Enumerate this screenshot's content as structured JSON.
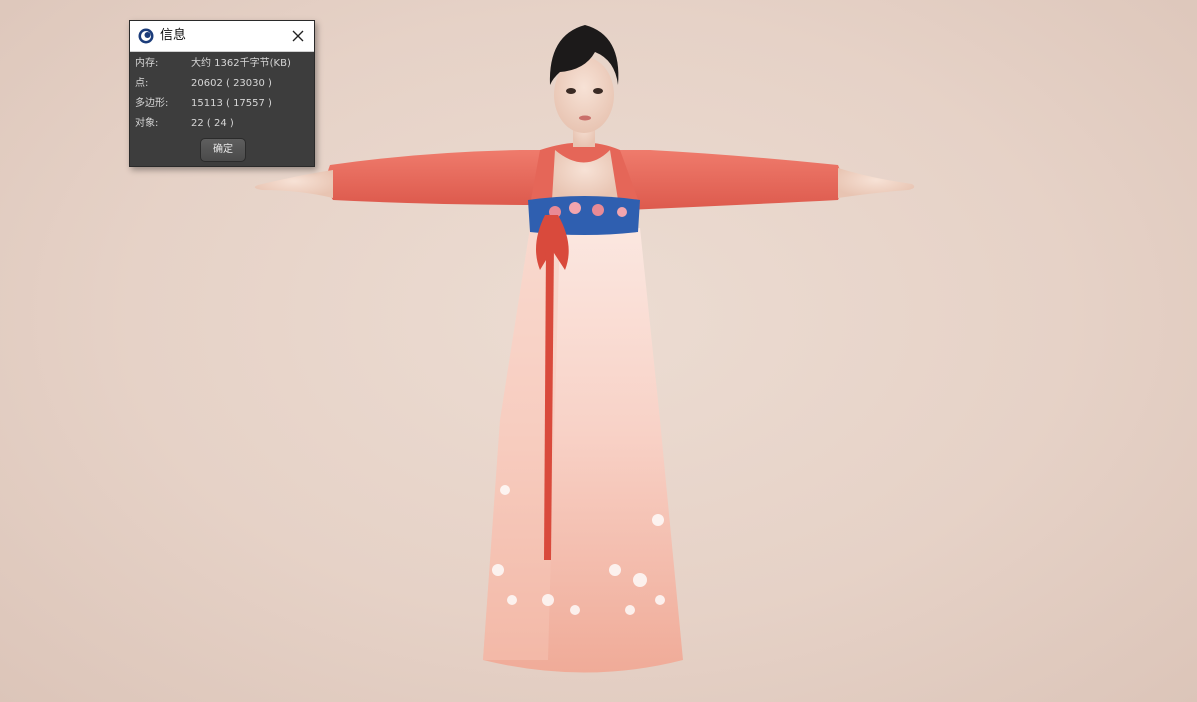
{
  "dialog": {
    "title": "信息",
    "icon": "cinema4d-app-icon",
    "close_icon": "close-icon",
    "rows": [
      {
        "label": "内存:",
        "value": "大约 1362千字节(KB)"
      },
      {
        "label": "点:",
        "value": "20602 ( 23030 )"
      },
      {
        "label": "多边形:",
        "value": "15113 ( 17557 )"
      },
      {
        "label": "对象:",
        "value": "22 ( 24 )"
      }
    ],
    "ok_label": "确定"
  },
  "viewport": {
    "background_color": "#e8d6cc",
    "model": "hanfu-female-character-tpose"
  },
  "colors": {
    "dialog_bg": "#3d3d3d",
    "titlebar_bg": "#ffffff",
    "sleeve": "#e8675a",
    "skirt": "#f3b8a8",
    "waistband": "#2f5fb0",
    "sash": "#d94a3c"
  }
}
